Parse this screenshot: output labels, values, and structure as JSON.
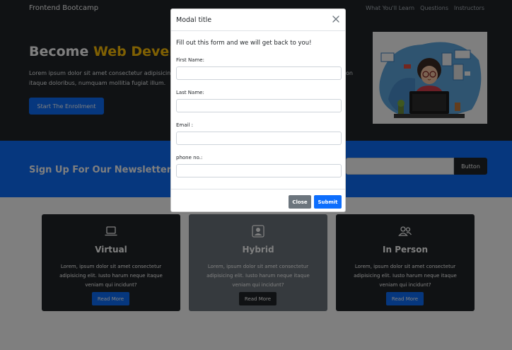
{
  "navbar": {
    "brand": "Frontend Bootcamp",
    "links": [
      "What You'll Learn",
      "Questions",
      "Instructors"
    ]
  },
  "hero": {
    "title_prefix": "Become ",
    "title_accent": "Web Develop",
    "text": "Lorem ipsum dolor sit amet consectetur adipisicing elit. Quod, repellendus animi suscipit dolorem voluptatem non itaque doloribus, numquam mollitia fugiat illum.",
    "button_label": "Start The Enrollment",
    "accent_color": "#ffc107"
  },
  "newsletter": {
    "title": "Sign Up For Our Newsletter!",
    "button_label": "Button"
  },
  "cards": [
    {
      "title": "Virtual",
      "icon": "laptop-icon",
      "text": "Lorem, ipsum dolor sit amet consectetur adipisicing elit. Iusto harum neque itaque veniam qui incidunt?",
      "button_label": "Read More"
    },
    {
      "title": "Hybrid",
      "icon": "person-badge-icon",
      "text": "Lorem, ipsum dolor sit amet consectetur adipisicing elit. Iusto harum neque itaque veniam qui incidunt?",
      "button_label": "Read More"
    },
    {
      "title": "In Person",
      "icon": "people-icon",
      "text": "Lorem, ipsum dolor sit amet consectetur adipisicing elit. Iusto harum neque itaque veniam qui incidunt?",
      "button_label": "Read More"
    }
  ],
  "modal": {
    "title": "Modal title",
    "intro": "Fill out this form and we will get back to you!",
    "fields": [
      {
        "label": "First Name:",
        "value": "",
        "placeholder": ""
      },
      {
        "label": "Last Name:",
        "value": "",
        "placeholder": ""
      },
      {
        "label": "Email :",
        "value": "",
        "placeholder": ""
      },
      {
        "label": "phone no.:",
        "value": "",
        "placeholder": ""
      }
    ],
    "close_label": "Close",
    "submit_label": "Submit"
  },
  "colors": {
    "primary": "#0d6efd",
    "dark": "#212529",
    "secondary": "#6c757d",
    "warning": "#ffc107"
  }
}
